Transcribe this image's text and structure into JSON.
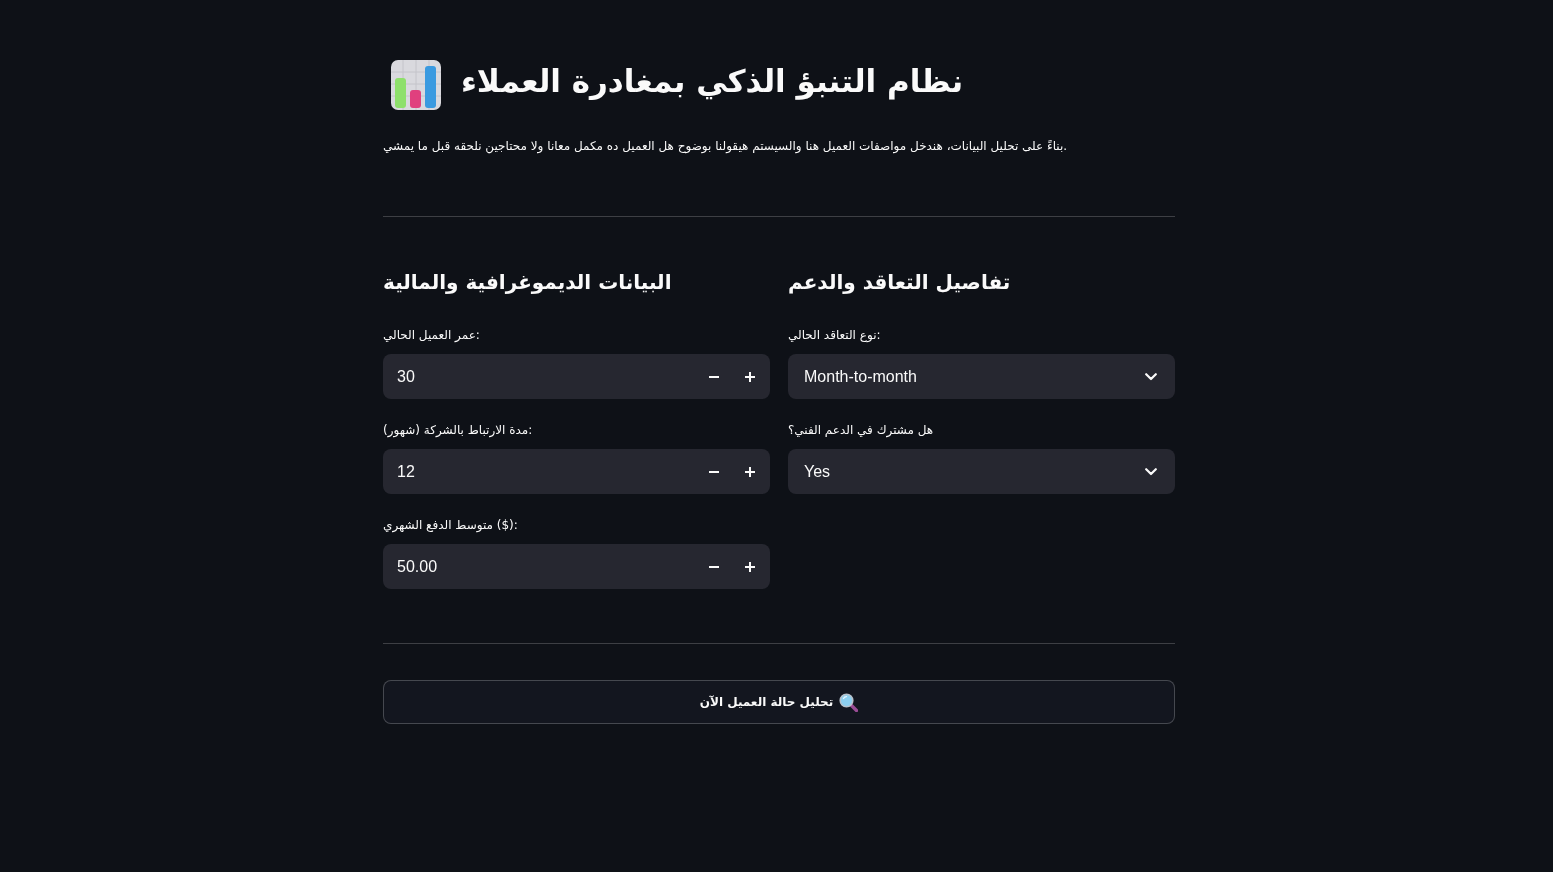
{
  "header": {
    "title": "نظام التنبؤ الذكي بمغادرة العملاء",
    "description": "بناءً على تحليل البيانات، هندخل مواصفات العميل هنا والسيستم هيقولنا بوضوح هل العميل ده مكمل معانا ولا محتاجين نلحقه قبل ما يمشي."
  },
  "columns": [
    {
      "heading": "تفاصيل التعاقد والدعم",
      "fields": [
        {
          "kind": "select",
          "label": "نوع التعاقد الحالي:",
          "value": "Month-to-month"
        },
        {
          "kind": "select",
          "label": "هل مشترك في الدعم الفني؟",
          "value": "Yes"
        }
      ]
    },
    {
      "heading": "البيانات الديموغرافية والمالية",
      "fields": [
        {
          "kind": "number",
          "label": "عمر العميل الحالي:",
          "value": "30"
        },
        {
          "kind": "number",
          "label": "مدة الارتباط بالشركة (شهور):",
          "value": "12"
        },
        {
          "kind": "number",
          "label": "متوسط الدفع الشهري ($):",
          "value": "50.00"
        }
      ]
    }
  ],
  "analyze_button": {
    "label": "تحليل حالة العميل الآن"
  }
}
